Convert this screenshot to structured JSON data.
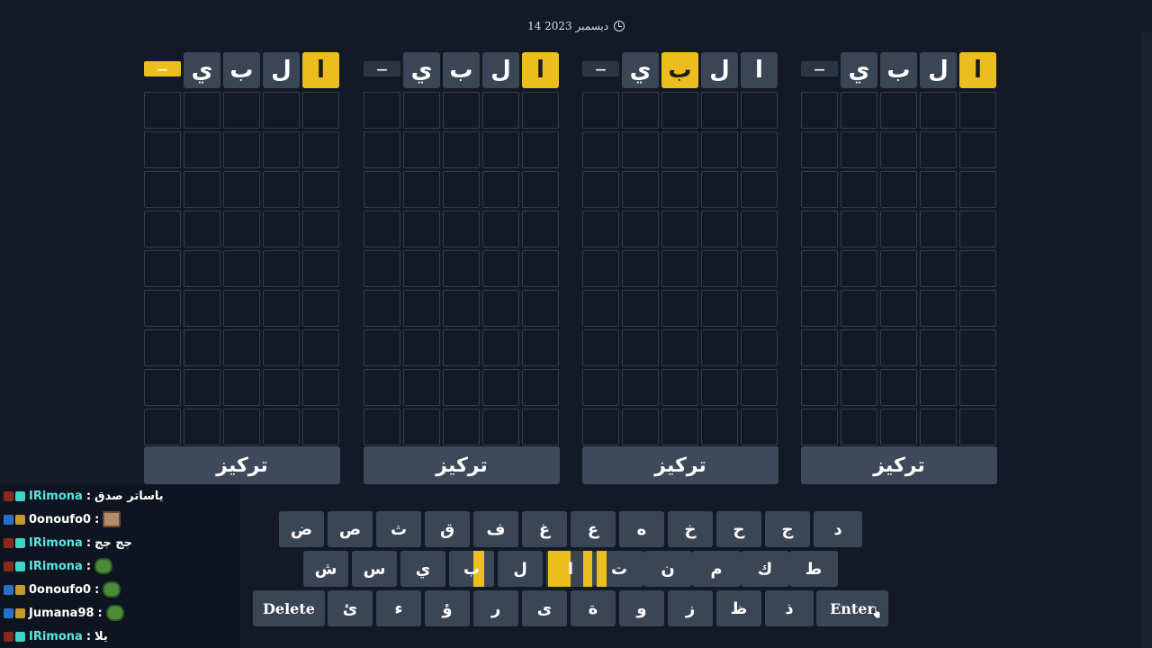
{
  "header": {
    "date": "14 ديسمبر 2023"
  },
  "boards": [
    {
      "header": [
        "ا",
        "ل",
        "ب",
        "ي"
      ],
      "header_states": [
        "yellow",
        "gray",
        "gray",
        "gray"
      ],
      "dash": "—",
      "dash_state": "yellow",
      "focus_label": "تركيز"
    },
    {
      "header": [
        "ا",
        "ل",
        "ب",
        "ي"
      ],
      "header_states": [
        "yellow",
        "gray",
        "gray",
        "gray"
      ],
      "dash": "—",
      "dash_state": "gray",
      "focus_label": "تركيز"
    },
    {
      "header": [
        "ا",
        "ل",
        "ب",
        "ي"
      ],
      "header_states": [
        "gray",
        "gray",
        "yellow",
        "gray"
      ],
      "dash": "—",
      "dash_state": "gray",
      "focus_label": "تركيز"
    },
    {
      "header": [
        "ا",
        "ل",
        "ب",
        "ي"
      ],
      "header_states": [
        "yellow",
        "gray",
        "gray",
        "gray"
      ],
      "dash": "—",
      "dash_state": "gray",
      "focus_label": "تركيز"
    }
  ],
  "grid": {
    "rows": 9,
    "cols": 5
  },
  "keyboard": {
    "row1": [
      "ض",
      "ص",
      "ث",
      "ق",
      "ف",
      "غ",
      "ع",
      "ه",
      "خ",
      "ح",
      "ج",
      "د"
    ],
    "row2": [
      "ش",
      "س",
      "ي",
      "ب",
      "ل",
      "ا",
      "ت",
      "ن",
      "م",
      "ك",
      "ط"
    ],
    "row3": [
      "Delete",
      "ئ",
      "ء",
      "ؤ",
      "ر",
      "ى",
      "ة",
      "و",
      "ز",
      "ظ",
      "ذ",
      "Enter"
    ]
  },
  "chat": [
    {
      "user": "IRimona",
      "msg": "ياساتر صدق",
      "badges": "mod",
      "emote": ""
    },
    {
      "user": "0onoufo0",
      "msg": "",
      "badges": "vip",
      "emote": "face"
    },
    {
      "user": "IRimona",
      "msg": "جج جج",
      "badges": "mod",
      "emote": ""
    },
    {
      "user": "IRimona",
      "msg": "",
      "badges": "mod",
      "emote": "frog"
    },
    {
      "user": "0onoufo0",
      "msg": "",
      "badges": "vip",
      "emote": "frog"
    },
    {
      "user": "Jumana98",
      "msg": "",
      "badges": "vip",
      "emote": "frog"
    },
    {
      "user": "IRimona",
      "msg": "يلا",
      "badges": "mod",
      "emote": ""
    }
  ],
  "colors": {
    "yellow": "#ecbe1d",
    "tile": "#3a4556",
    "background": "#131a26"
  }
}
